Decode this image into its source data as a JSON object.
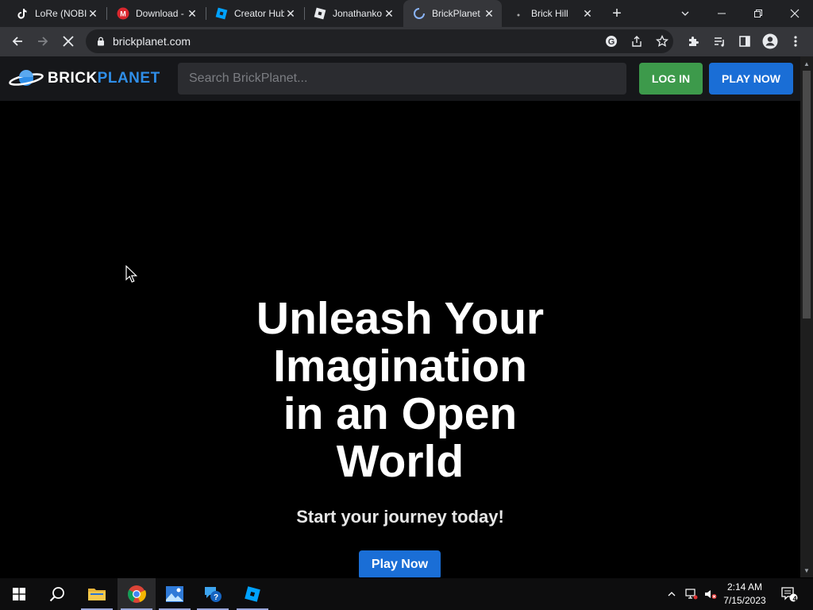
{
  "browser": {
    "tabs": [
      {
        "title": "LoRe (NOBI",
        "favicon": "tiktok-icon"
      },
      {
        "title": "Download -",
        "favicon": "mega-icon"
      },
      {
        "title": "Creator Hub",
        "favicon": "roblox-studio-icon"
      },
      {
        "title": "Jonathanko",
        "favicon": "roblox-icon"
      },
      {
        "title": "BrickPlanet",
        "favicon": "loading-spinner-icon",
        "active": true
      },
      {
        "title": "Brick Hill",
        "favicon": "brick-hill-icon"
      }
    ],
    "url": "brickplanet.com"
  },
  "site": {
    "logo": {
      "part1": "BRICK",
      "part2": "PLANET"
    },
    "search_placeholder": "Search BrickPlanet...",
    "login_label": "LOG IN",
    "play_label": "PLAY NOW",
    "hero": {
      "line1": "Unleash Your",
      "line2": "Imagination",
      "line3": "in an Open",
      "line4": "World",
      "subtitle": "Start your journey today!",
      "cta": "Play Now"
    }
  },
  "taskbar": {
    "clock_time": "2:14 AM",
    "clock_date": "7/15/2023",
    "notification_count": "4"
  },
  "colors": {
    "green_button": "#3d9a4b",
    "blue_button": "#1a6ed6",
    "logo_blue": "#2f8ee8"
  }
}
